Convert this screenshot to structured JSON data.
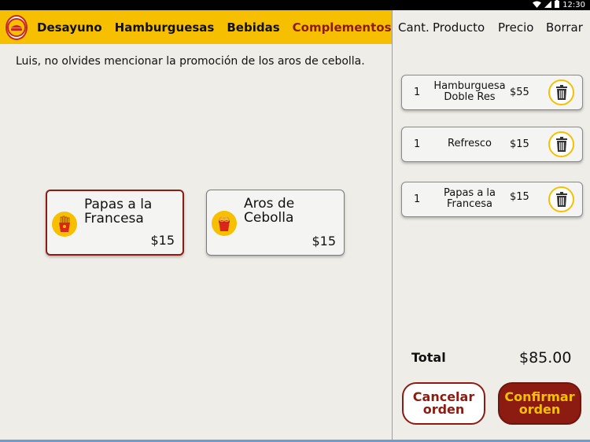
{
  "statusbar": {
    "time": "12:30"
  },
  "brand": {
    "logo_text": "BURGER QUEEN"
  },
  "nav": {
    "tabs": [
      {
        "label": "Desayuno",
        "active": false
      },
      {
        "label": "Hamburguesas",
        "active": false
      },
      {
        "label": "Bebidas",
        "active": false
      },
      {
        "label": "Complementos",
        "active": true
      }
    ]
  },
  "notice": "Luis, no olvides mencionar la promoción de los aros de cebolla.",
  "products": [
    {
      "name": "Papas a la Francesa",
      "price": "$15",
      "icon": "fries-icon",
      "selected": true
    },
    {
      "name": "Aros de Cebolla",
      "price": "$15",
      "icon": "onion-rings-icon",
      "selected": false
    }
  ],
  "cart": {
    "headers": {
      "qty": "Cant.",
      "product": "Producto",
      "price": "Precio",
      "delete": "Borrar"
    },
    "items": [
      {
        "qty": "1",
        "name": "Hamburguesa Doble Res",
        "price": "$55"
      },
      {
        "qty": "1",
        "name": "Refresco",
        "price": "$15"
      },
      {
        "qty": "1",
        "name": "Papas a la Francesa",
        "price": "$15"
      }
    ],
    "total_label": "Total",
    "total_value": "$85.00",
    "cancel_label": "Cancelar orden",
    "confirm_label": "Confirmar orden"
  },
  "colors": {
    "accent_yellow": "#f6c000",
    "brand_red": "#8c1c12",
    "background": "#efede8"
  }
}
